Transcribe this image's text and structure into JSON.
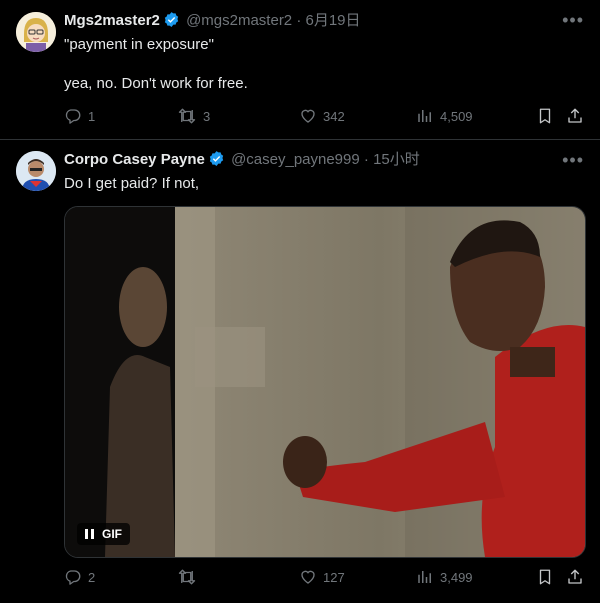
{
  "tweets": [
    {
      "display_name": "Mgs2master2",
      "handle": "@mgs2master2",
      "separator": "·",
      "timestamp": "6月19日",
      "lines": [
        "\"payment in exposure\"",
        "yea, no. Don't work for free."
      ],
      "stats": {
        "replies": "1",
        "reposts": "3",
        "likes": "342",
        "views": "4,509"
      }
    },
    {
      "display_name": "Corpo Casey Payne",
      "handle": "@casey_payne999",
      "separator": "·",
      "timestamp": "15小时",
      "lines": [
        "Do I get paid? If not,"
      ],
      "media_badge": "GIF",
      "stats": {
        "replies": "2",
        "reposts": "",
        "likes": "127",
        "views": "3,499"
      }
    }
  ],
  "colors": {
    "background": "#000000",
    "text": "#e7e9ea",
    "muted": "#71767b",
    "verified": "#1d9bf0",
    "divider": "#2f3336"
  },
  "icons": {
    "more": "more-icon",
    "reply": "reply-icon",
    "repost": "repost-icon",
    "like": "heart-icon",
    "views": "views-icon",
    "bookmark": "bookmark-icon",
    "share": "share-icon",
    "verified": "verified-badge-icon",
    "pause": "pause-icon"
  }
}
